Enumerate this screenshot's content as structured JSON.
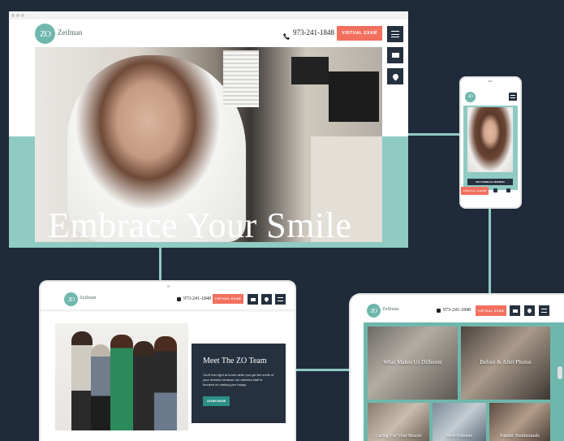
{
  "desktop": {
    "brand": {
      "monogram": "ZO",
      "name": "Zeifman"
    },
    "phone": "973-241-1848",
    "cta_label": "VIRTUAL EXAM",
    "hero_title": "Embrace Your Smile"
  },
  "phone_mock": {
    "cta_label": "DR. DANIELLE ZEIFMAN",
    "bottom_cta": "VIRTUAL EXAM"
  },
  "tablet": {
    "brand": {
      "monogram": "ZO",
      "name": "Zeifman"
    },
    "phone": "973-241-1848",
    "cta_label": "VIRTUAL EXAM",
    "team_title": "Meet The ZO Team",
    "team_text": "You'll feel right at home while you get the smile of your dreams because our talented staff is focused on making you happy.",
    "team_button": "LEARN MORE"
  },
  "laptop": {
    "brand": {
      "monogram": "ZO",
      "name": "Zeifman"
    },
    "phone": "973-241-1848",
    "cta_label": "VIRTUAL EXAM",
    "tiles": [
      "What Makes Us Different",
      "Before & After Photos",
      "Caring For Your Braces",
      "New Patients",
      "Patient Testimonials"
    ]
  },
  "colors": {
    "background": "#1f2b3a",
    "accent": "#f3705f",
    "teal": "#8fcac3",
    "navy": "#25313f"
  }
}
